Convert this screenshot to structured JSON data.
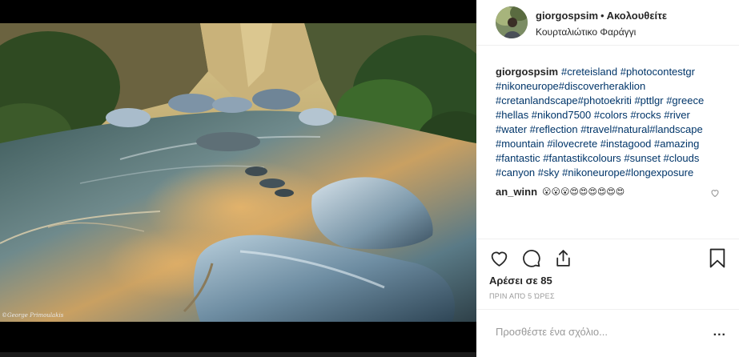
{
  "post": {
    "username": "giorgospsim",
    "separator": "•",
    "follow_label": "Ακολουθείτε",
    "location": "Κουρταλιώτικο Φαράγγι",
    "image_watermark": "©George Primoulakis",
    "caption_username": "giorgospsim",
    "caption_lines": [
      "#creteisland #photocontestgr",
      "#nikoneurope#discoverheraklion",
      "#cretanlandscape#photoekriti #pttlgr #greece",
      "#hellas #nikond7500 #colors #rocks #river",
      "#water #reflection #travel#natural#landscape",
      "#mountain #ilovecrete #instagood #amazing",
      "#fantastic #fantastikcolours #sunset #clouds",
      "#canyon #sky #nikoneurope#longexposure"
    ],
    "comment": {
      "username": "an_winn",
      "text": "😮😮😮😍😍😍😍😍😍"
    },
    "likes_label": "Αρέσει σε 85",
    "timestamp": "ΠΡΙΝ ΑΠΌ 5 ΏΡΕΣ",
    "add_comment_placeholder": "Προσθέστε ένα σχόλιο...",
    "more_label": "..."
  },
  "icons": {
    "like": "heart-icon",
    "comment": "comment-icon",
    "share": "share-icon",
    "save": "bookmark-icon",
    "comment_like": "heart-icon",
    "more": "more-options-icon"
  },
  "colors": {
    "hashtag": "#003569",
    "text": "#262626",
    "muted": "#999999",
    "border": "#efefef"
  }
}
